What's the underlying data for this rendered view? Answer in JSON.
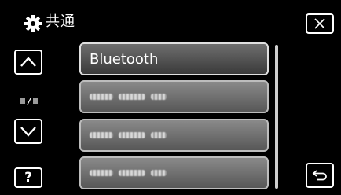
{
  "header": {
    "title": "共通"
  },
  "menu": {
    "items": [
      {
        "label": "Bluetooth",
        "selected": true
      },
      {
        "label": "",
        "selected": false,
        "obscured": true
      },
      {
        "label": "",
        "selected": false,
        "obscured": true
      },
      {
        "label": "",
        "selected": false,
        "obscured": true
      }
    ]
  },
  "nav": {
    "help_label": "?"
  },
  "icons": {
    "header": "gear-icon",
    "close": "close-icon",
    "up": "chevron-up-icon",
    "down": "chevron-down-icon",
    "page": "page-indicator-icon",
    "back": "return-icon"
  }
}
